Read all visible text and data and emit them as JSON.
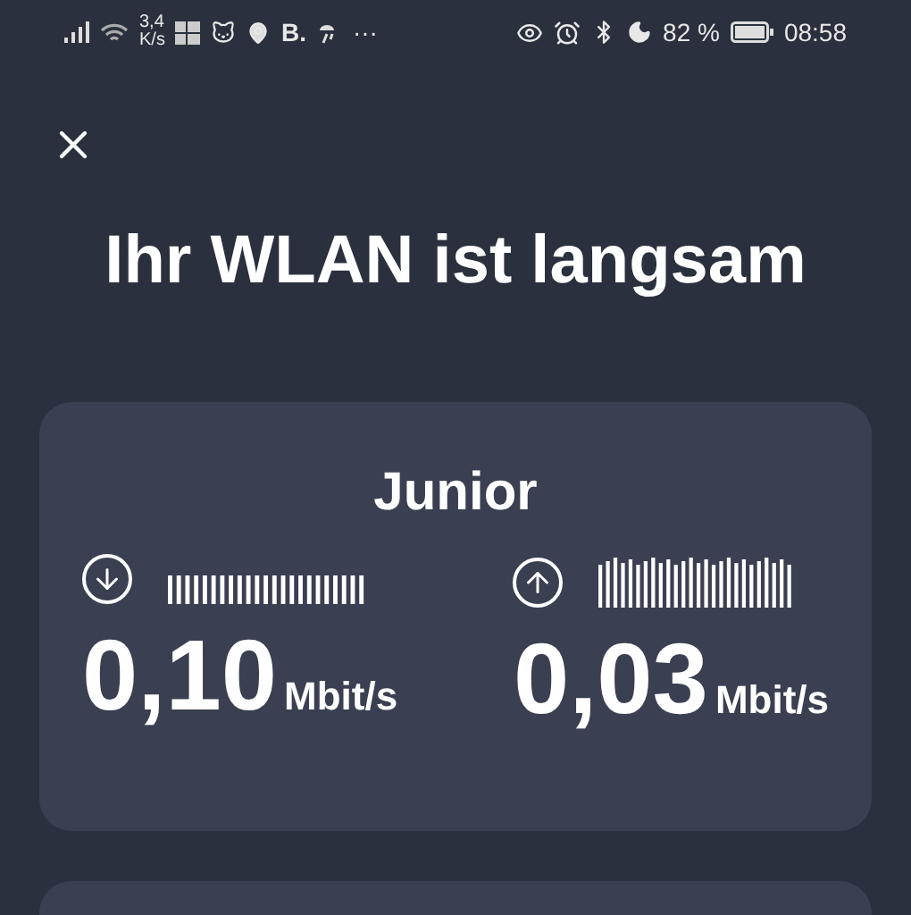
{
  "status_bar": {
    "net_speed_value": "3,4",
    "net_speed_unit": "K/s",
    "carrier_mark": "B.",
    "more": "···",
    "battery_percent": "82 %",
    "time": "08:58"
  },
  "title": "Ihr WLAN ist langsam",
  "card": {
    "name": "Junior",
    "speeds": [
      {
        "kind": "download",
        "value": "0,10",
        "unit": "Mbit/s"
      },
      {
        "kind": "upload",
        "value": "0,03",
        "unit": "Mbit/s"
      }
    ]
  }
}
